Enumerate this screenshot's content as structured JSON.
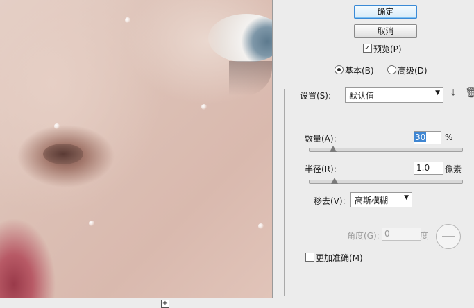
{
  "dialog": {
    "ok_label": "确定",
    "cancel_label": "取消",
    "preview_label": "预览(P)",
    "preview_checked": true,
    "mode_basic_label": "基本(B)",
    "mode_advanced_label": "高级(D)",
    "mode_selected": "basic"
  },
  "settings": {
    "label": "设置(S):",
    "value": "默认值"
  },
  "amount": {
    "label": "数量(A):",
    "value": "30",
    "unit": "%",
    "level": 0.06
  },
  "radius": {
    "label": "半径(R):",
    "value": "1.0",
    "unit": "像素",
    "level": 0.08
  },
  "remove": {
    "label": "移去(V):",
    "value": "高斯模糊"
  },
  "angle": {
    "label": "角度(G):",
    "value": "0",
    "unit": "度"
  },
  "more_accurate": {
    "label": "更加准确(M)",
    "checked": false
  },
  "icons": {
    "save": "save-preset-icon",
    "delete": "trash-icon",
    "zoom": "plus-icon"
  }
}
